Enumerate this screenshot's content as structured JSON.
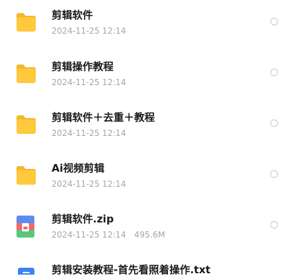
{
  "files": [
    {
      "name": "剪辑软件",
      "date": "2024-11-25 12:14",
      "size": "",
      "type": "folder",
      "icon": "folder-icon"
    },
    {
      "name": "剪辑操作教程",
      "date": "2024-11-25 12:14",
      "size": "",
      "type": "folder",
      "icon": "folder-icon"
    },
    {
      "name": "剪辑软件＋去重＋教程",
      "date": "2024-11-25 12:14",
      "size": "",
      "type": "folder",
      "icon": "folder-icon"
    },
    {
      "name": "Ai视频剪辑",
      "date": "2024-11-25 12:14",
      "size": "",
      "type": "folder",
      "icon": "folder-icon"
    },
    {
      "name": "剪辑软件.zip",
      "date": "2024-11-25 12:14",
      "size": "495.6M",
      "type": "zip",
      "icon": "zip-archive-icon"
    },
    {
      "name": "剪辑安装教程-首先看照着操作.txt",
      "date": "",
      "size": "",
      "type": "txt",
      "icon": "text-file-icon"
    }
  ],
  "colors": {
    "folder": "#ffc93d",
    "folder_tab": "#f5b62a",
    "title": "#1a1a1a",
    "meta": "#a6a6a6",
    "radio_border": "#c8c8c8",
    "txt_icon": "#3b82f6"
  }
}
